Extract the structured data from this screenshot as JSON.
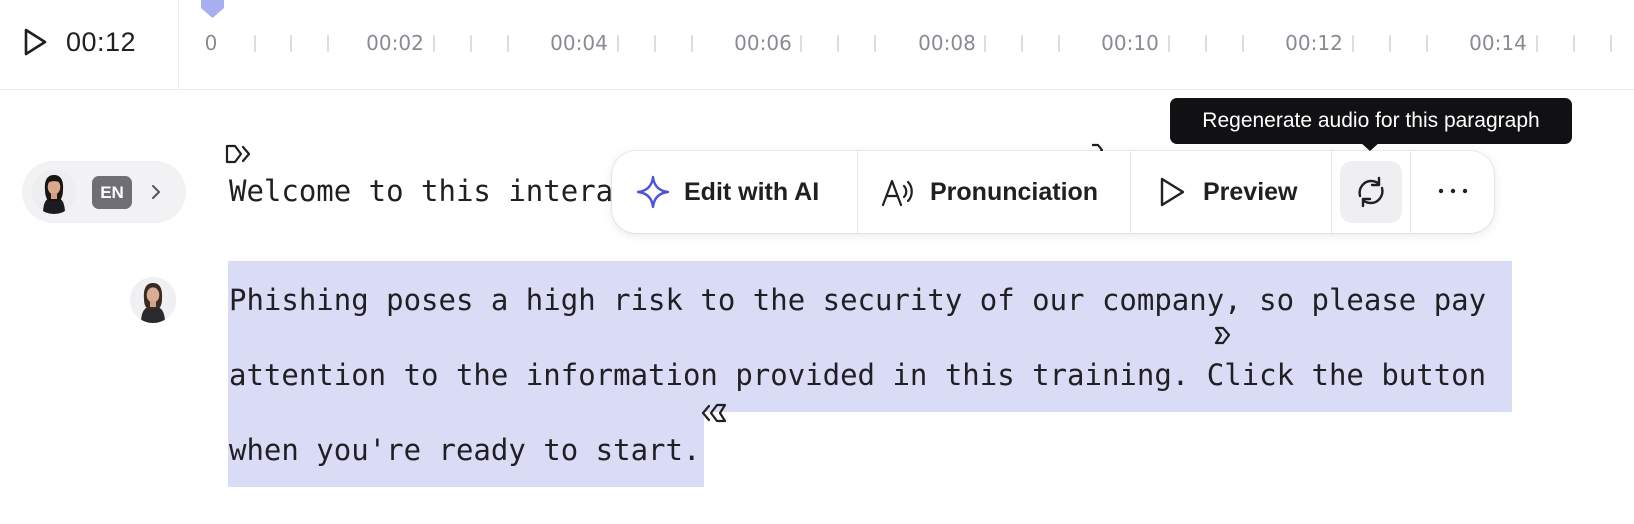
{
  "player": {
    "current_time": "00:12",
    "play_icon": "play-icon"
  },
  "timeline": {
    "labels": [
      "0",
      "00:02",
      "00:04",
      "00:06",
      "00:08",
      "00:10",
      "00:12",
      "00:14"
    ],
    "playhead_icon": "playhead-marker",
    "accent_color": "#a9aef0"
  },
  "speaker": {
    "language": "EN",
    "chevron_icon": "chevron-right-icon"
  },
  "script": {
    "paragraph_1": "Welcome to this intera",
    "paragraph_2_lines": [
      "Phishing poses a high risk to the security of our company, so please pay",
      "attention to the information provided in this training. Click the button",
      "when you're ready to start."
    ],
    "highlight_color": "#dadcf6"
  },
  "toolbar": {
    "edit_ai_label": "Edit with AI",
    "pronunciation_label": "Pronunciation",
    "preview_label": "Preview",
    "regenerate_icon": "refresh-icon",
    "more_icon": "more-horizontal-icon",
    "ai_icon_color": "#4b55d6"
  },
  "tooltip": {
    "text": "Regenerate audio for this paragraph"
  }
}
